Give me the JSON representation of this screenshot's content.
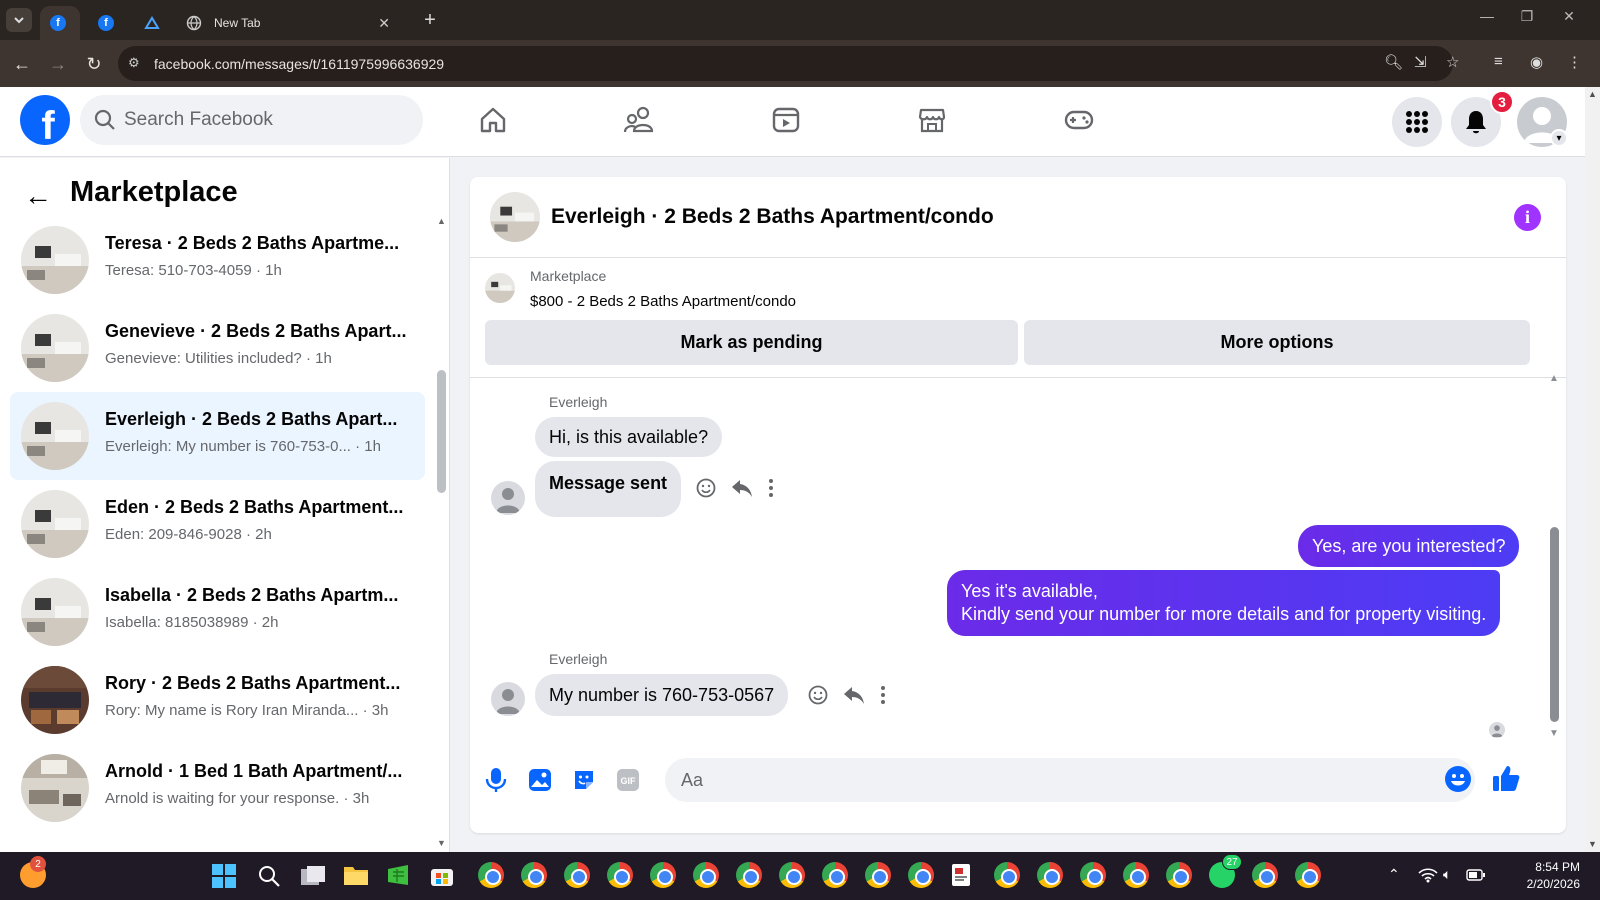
{
  "browser": {
    "tabs": [
      {
        "title": "",
        "favicon": "facebook-icon"
      },
      {
        "title": "",
        "favicon": "facebook-icon"
      },
      {
        "title": "",
        "favicon": "app-icon"
      },
      {
        "title": "New Tab",
        "favicon": "globe-icon"
      }
    ],
    "url": "facebook.com/messages/t/1611975996636929"
  },
  "header": {
    "search_placeholder": "Search Facebook",
    "notification_count": "3"
  },
  "sidebar": {
    "title": "Marketplace",
    "conversations": [
      {
        "title": "Teresa · 2 Beds 2 Baths Apartme...",
        "subtitle": "Teresa: 510-703-4059 · 1h",
        "active": false
      },
      {
        "title": "Genevieve · 2 Beds 2 Baths Apart...",
        "subtitle": "Genevieve: Utilities included? · 1h",
        "active": false
      },
      {
        "title": "Everleigh · 2 Beds 2 Baths Apart...",
        "subtitle": "Everleigh: My number is 760-753-0...  · 1h",
        "active": true
      },
      {
        "title": "Eden · 2 Beds 2 Baths Apartment...",
        "subtitle": "Eden: 209-846-9028 · 2h",
        "active": false
      },
      {
        "title": "Isabella · 2 Beds 2 Baths Apartm...",
        "subtitle": "Isabella: 8185038989 · 2h",
        "active": false
      },
      {
        "title": "Rory · 2 Beds 2 Baths Apartment...",
        "subtitle": "Rory: My name is Rory Iran Miranda... · 3h",
        "active": false
      },
      {
        "title": "Arnold · 1 Bed 1 Bath Apartment/...",
        "subtitle": "Arnold is waiting for your response. · 3h",
        "active": false
      }
    ]
  },
  "chat": {
    "title": "Everleigh · 2 Beds 2 Baths Apartment/condo",
    "listing_label": "Marketplace",
    "listing_price": "$800 - 2 Beds 2 Baths Apartment/condo",
    "mark_pending": "Mark as pending",
    "more_options": "More options",
    "messages": {
      "sender1": "Everleigh",
      "m1": "Hi, is this available?",
      "m2": "Message sent",
      "m3": "Yes, are you interested?",
      "m4_line1": "Yes it's available,",
      "m4_line2": "Kindly send your number for more details and for property visiting.",
      "sender2": "Everleigh",
      "m5": "My number is 760-753-0567"
    },
    "composer_placeholder": "Aa"
  },
  "taskbar": {
    "time": "8:54 PM",
    "date": "2/20/2026",
    "whatsapp_badge": "27",
    "firefox_badge": "2"
  },
  "colors": {
    "fb_blue": "#0866ff",
    "outgoing_bubble": "#5b3cf5",
    "active_conv": "#ebf5ff",
    "badge_red": "#e41e3f"
  }
}
